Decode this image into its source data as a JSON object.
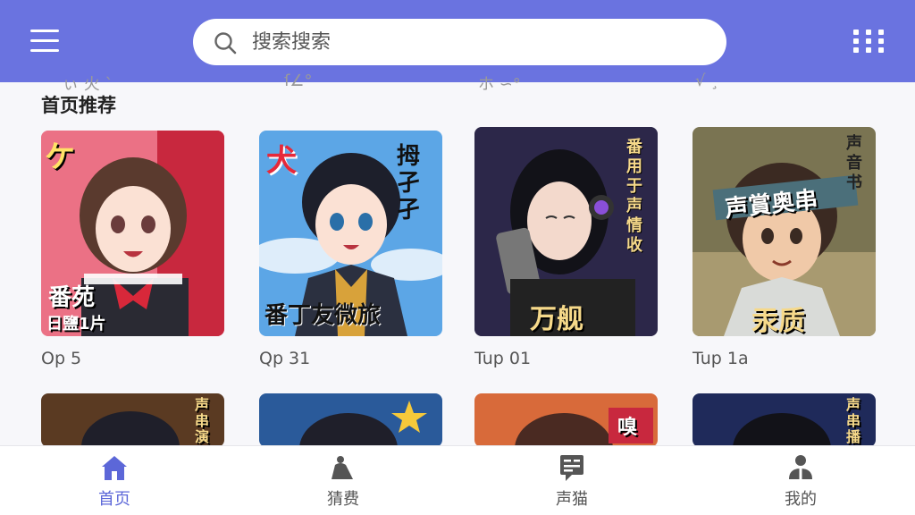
{
  "header": {
    "search_placeholder": "搜索搜索"
  },
  "scrolled_labels": [
    "ぃ 火 `",
    "ſ∠°",
    "ホ ∽°",
    "√ ¸"
  ],
  "section": {
    "title": "首页推荐"
  },
  "cards": [
    {
      "label": "Op 5",
      "cover_text_top": "ケ",
      "cover_text_bottom": "番苑",
      "cover_text_sub": "日鹽1片"
    },
    {
      "label": "Qp 31",
      "cover_text_top": "犬",
      "cover_text_bottom": "番丁友微旅",
      "cover_text_side": "拇孑孑"
    },
    {
      "label": "Tup 01",
      "cover_text_side": "番用于声情收",
      "cover_text_bottom": "万舰"
    },
    {
      "label": "Tup 1a",
      "cover_text_side": "声音书",
      "cover_text_band": "声賞奥串",
      "cover_text_bottom": "汞质"
    }
  ],
  "row2_texts": [
    "声串演",
    "",
    "嗅",
    "声串播"
  ],
  "bottom_nav": {
    "items": [
      {
        "label": "首页",
        "icon": "home-icon",
        "active": true
      },
      {
        "label": "猜费",
        "icon": "bell-icon",
        "active": false
      },
      {
        "label": "声猫",
        "icon": "message-icon",
        "active": false
      },
      {
        "label": "我的",
        "icon": "user-icon",
        "active": false
      }
    ]
  },
  "colors": {
    "primary": "#6a73e0",
    "active": "#5c67d8"
  }
}
